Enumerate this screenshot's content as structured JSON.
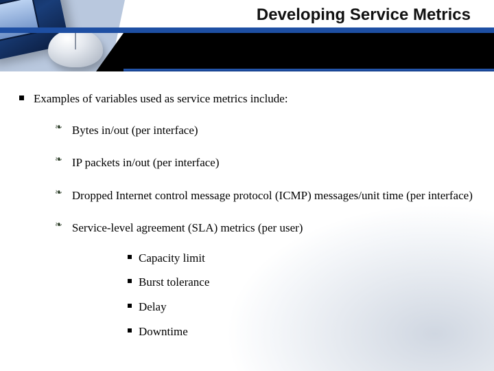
{
  "header": {
    "title": "Developing Service Metrics"
  },
  "content": {
    "intro": "Examples of variables used as service metrics include:",
    "vars": [
      {
        "text": "Bytes in/out (per interface)"
      },
      {
        "text": "IP packets in/out (per interface)"
      },
      {
        "text": "Dropped Internet control message protocol (ICMP) messages/unit time (per interface)"
      },
      {
        "text": "Service-level agreement (SLA) metrics (per user)",
        "sub": [
          "Capacity limit",
          "Burst tolerance",
          "Delay",
          "Downtime"
        ]
      }
    ]
  }
}
